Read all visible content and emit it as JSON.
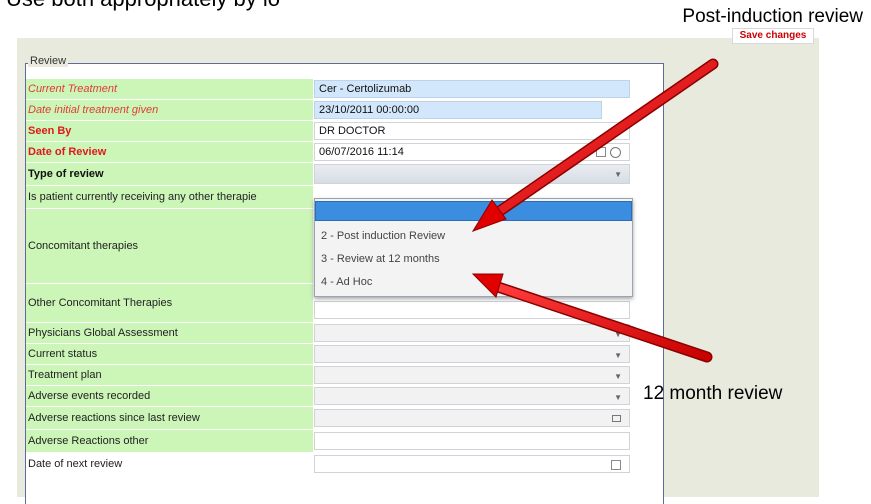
{
  "top_text": "Use both appropriately by lo",
  "callouts": {
    "top": "Post-induction review",
    "bottom": "12 month review"
  },
  "save_label": "Save changes",
  "legend": "Review",
  "rows": [
    {
      "label": "Current Treatment",
      "value": "Cer - Certolizumab"
    },
    {
      "label": "Date initial treatment given",
      "value": "23/10/2011 00:00:00"
    },
    {
      "label": "Seen By",
      "value": "DR DOCTOR"
    },
    {
      "label": "Date of Review",
      "value": "06/07/2016 11:14"
    },
    {
      "label": "Type of review",
      "value": ""
    },
    {
      "label": "Is patient currently receiving any other therapie",
      "value": ""
    },
    {
      "label": "Concomitant therapies",
      "value": ""
    },
    {
      "label": "Other Concomitant Therapies",
      "value": ""
    },
    {
      "label": "Physicians Global Assessment",
      "value": ""
    },
    {
      "label": "Current status",
      "value": ""
    },
    {
      "label": "Treatment plan",
      "value": ""
    },
    {
      "label": "Adverse events recorded",
      "value": ""
    },
    {
      "label": "Adverse reactions since last review",
      "value": ""
    },
    {
      "label": "Adverse Reactions other",
      "value": ""
    },
    {
      "label": "Date of next review",
      "value": ""
    }
  ],
  "dropdown_options": [
    "",
    "2 - Post induction Review",
    "3 - Review at 12 months",
    "4 - Ad Hoc"
  ],
  "colors": {
    "arrow": "#e00000",
    "accent_label_red": "#e0181e",
    "selected_option": "#3b8de0",
    "required_label_bg": "#ccf5b8"
  }
}
